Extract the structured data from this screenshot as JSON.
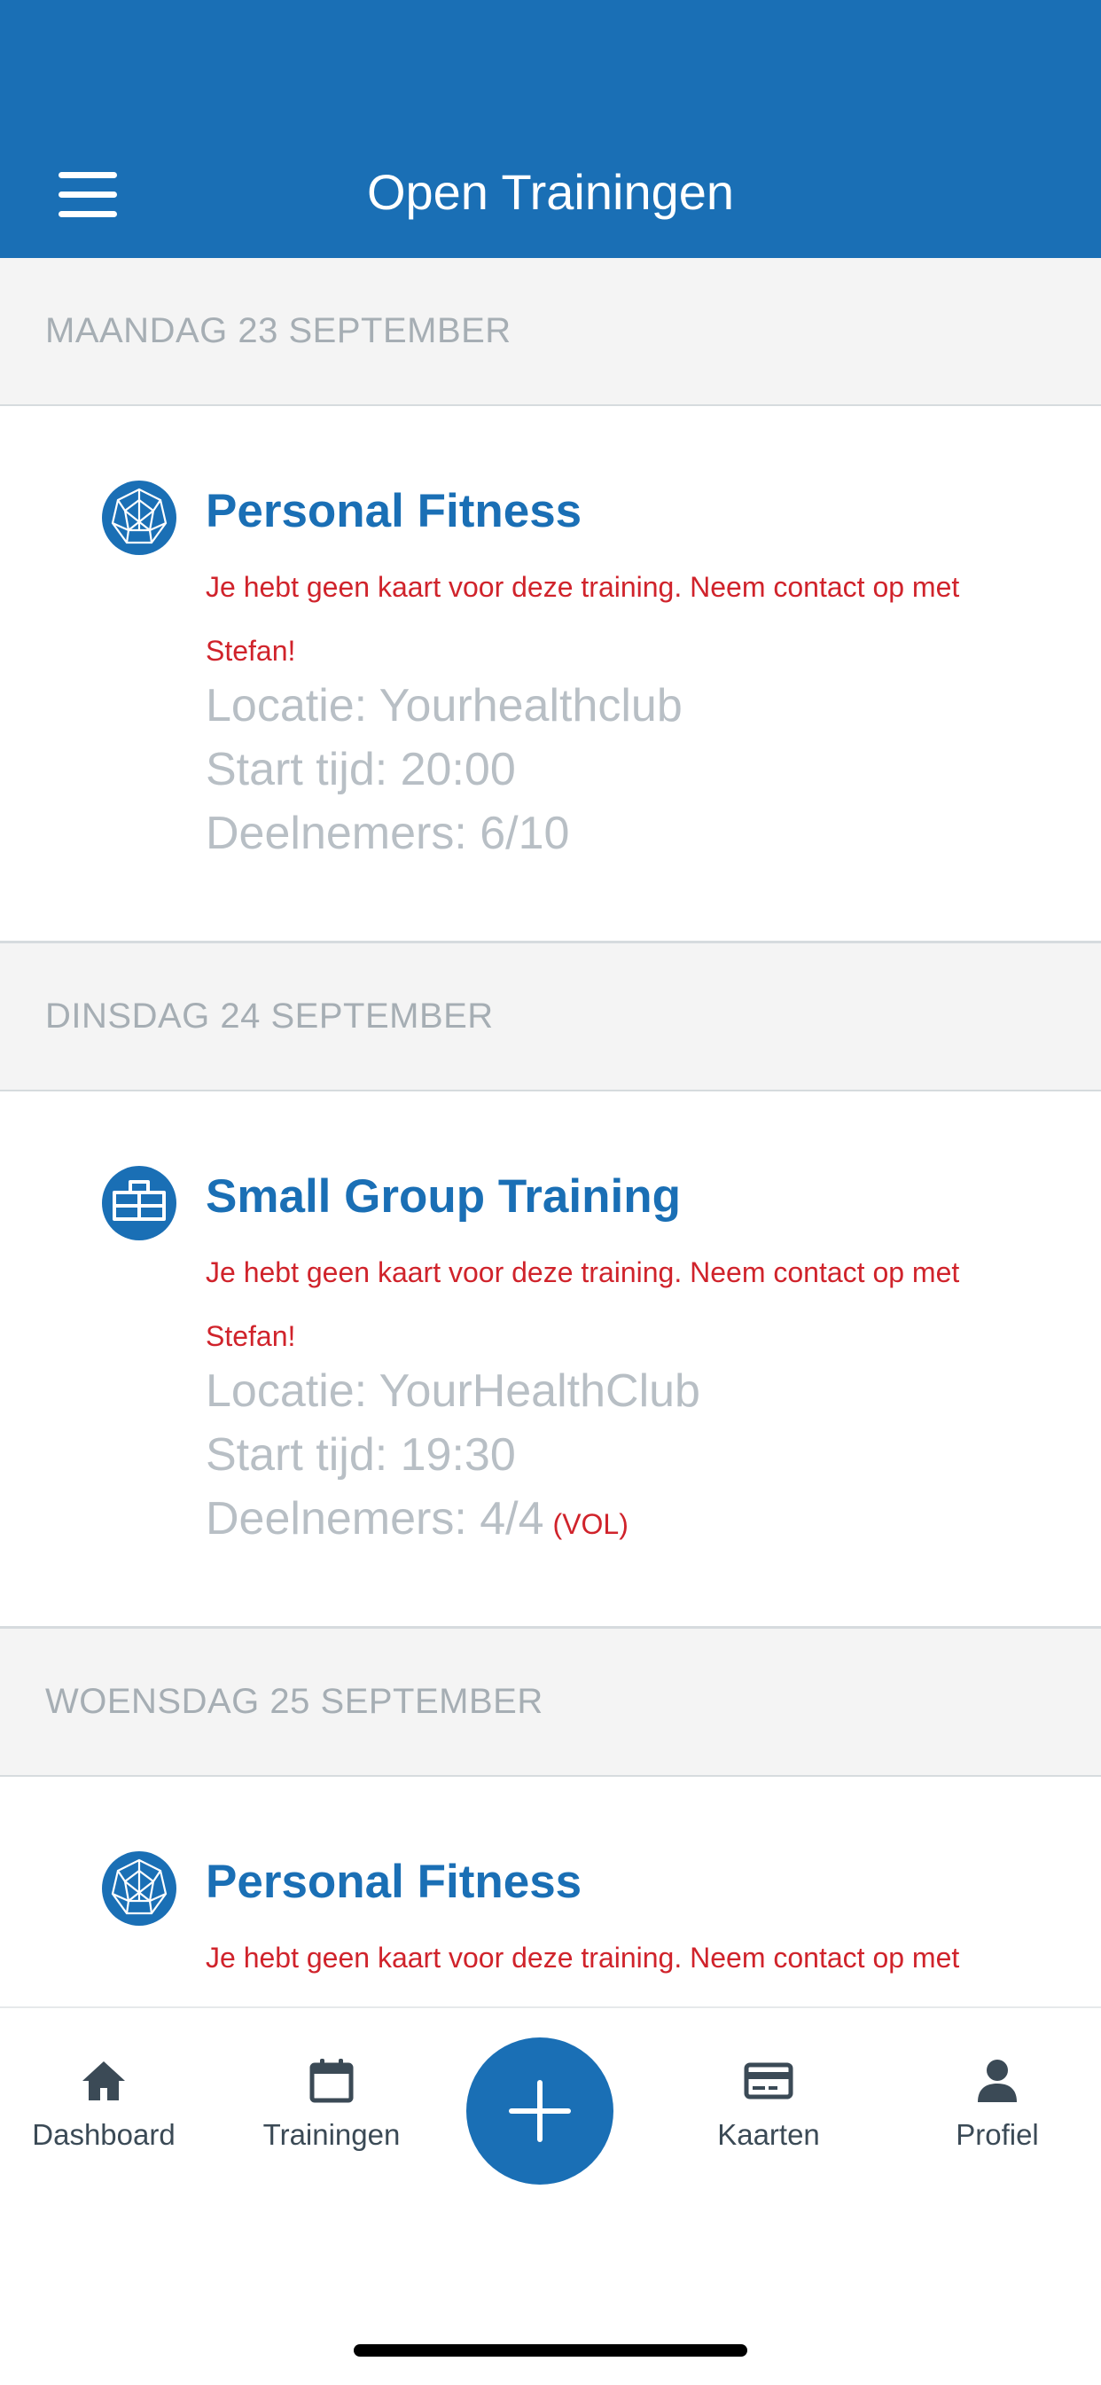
{
  "header": {
    "title": "Open Trainingen",
    "menu_icon": "hamburger-menu-icon"
  },
  "colors": {
    "brand": "#1a6fb5",
    "warning": "#d0232b",
    "muted": "#b8bfc5"
  },
  "days": [
    {
      "label": "MAANDAG 23 SEPTEMBER",
      "session": {
        "icon": "sphere-icon",
        "title": "Personal Fitness",
        "warning": "Je hebt geen kaart voor deze training. Neem contact op met Stefan!",
        "location": "Locatie: Yourhealthclub",
        "start": "Start tijd: 20:00",
        "participants": "Deelnemers: 6/10"
      }
    },
    {
      "label": "DINSDAG 24 SEPTEMBER",
      "session": {
        "icon": "group-icon",
        "title": "Small Group Training",
        "warning": "Je hebt geen kaart voor deze training. Neem contact op met Stefan!",
        "location": "Locatie: YourHealthClub",
        "start": "Start tijd: 19:30",
        "participants": "Deelnemers: 4/4",
        "full": "(VOL)"
      }
    },
    {
      "label": "WOENSDAG 25 SEPTEMBER",
      "session": {
        "icon": "sphere-icon",
        "title": "Personal Fitness",
        "warning": "Je hebt geen kaart voor deze training. Neem contact op met"
      }
    }
  ],
  "tabbar": {
    "tabs": [
      {
        "label": "Dashboard",
        "icon": "home-icon"
      },
      {
        "label": "Trainingen",
        "icon": "calendar-icon"
      },
      {
        "label": "Kaarten",
        "icon": "credit-card-icon"
      },
      {
        "label": "Profiel",
        "icon": "person-icon"
      }
    ],
    "add_icon": "plus-icon"
  }
}
